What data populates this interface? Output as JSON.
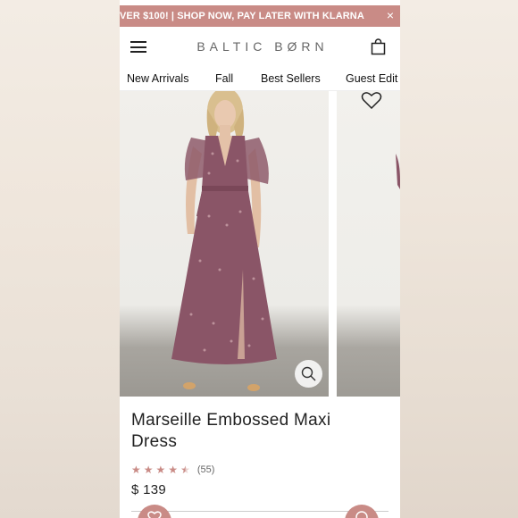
{
  "promo": {
    "text": "VER $100! | SHOP NOW, PAY LATER WITH KLARNA",
    "close_glyph": "×"
  },
  "header": {
    "logo": "BALTIC BØRN",
    "menu_icon": "hamburger-icon",
    "bag_icon": "shopping-bag-icon"
  },
  "nav": {
    "items": [
      "New Arrivals",
      "Fall",
      "Best Sellers",
      "Guest Edit"
    ]
  },
  "product": {
    "title": "Marseille Embossed Maxi Dress",
    "rating": 4.5,
    "rating_max": 5,
    "review_count": "(55)",
    "price": "$ 139"
  },
  "colors": {
    "accent": "#c98b86",
    "dress": "#8a5567",
    "text": "#222222"
  },
  "icons": {
    "zoom": "magnifier-icon",
    "wishlist": "heart-outline-icon"
  }
}
